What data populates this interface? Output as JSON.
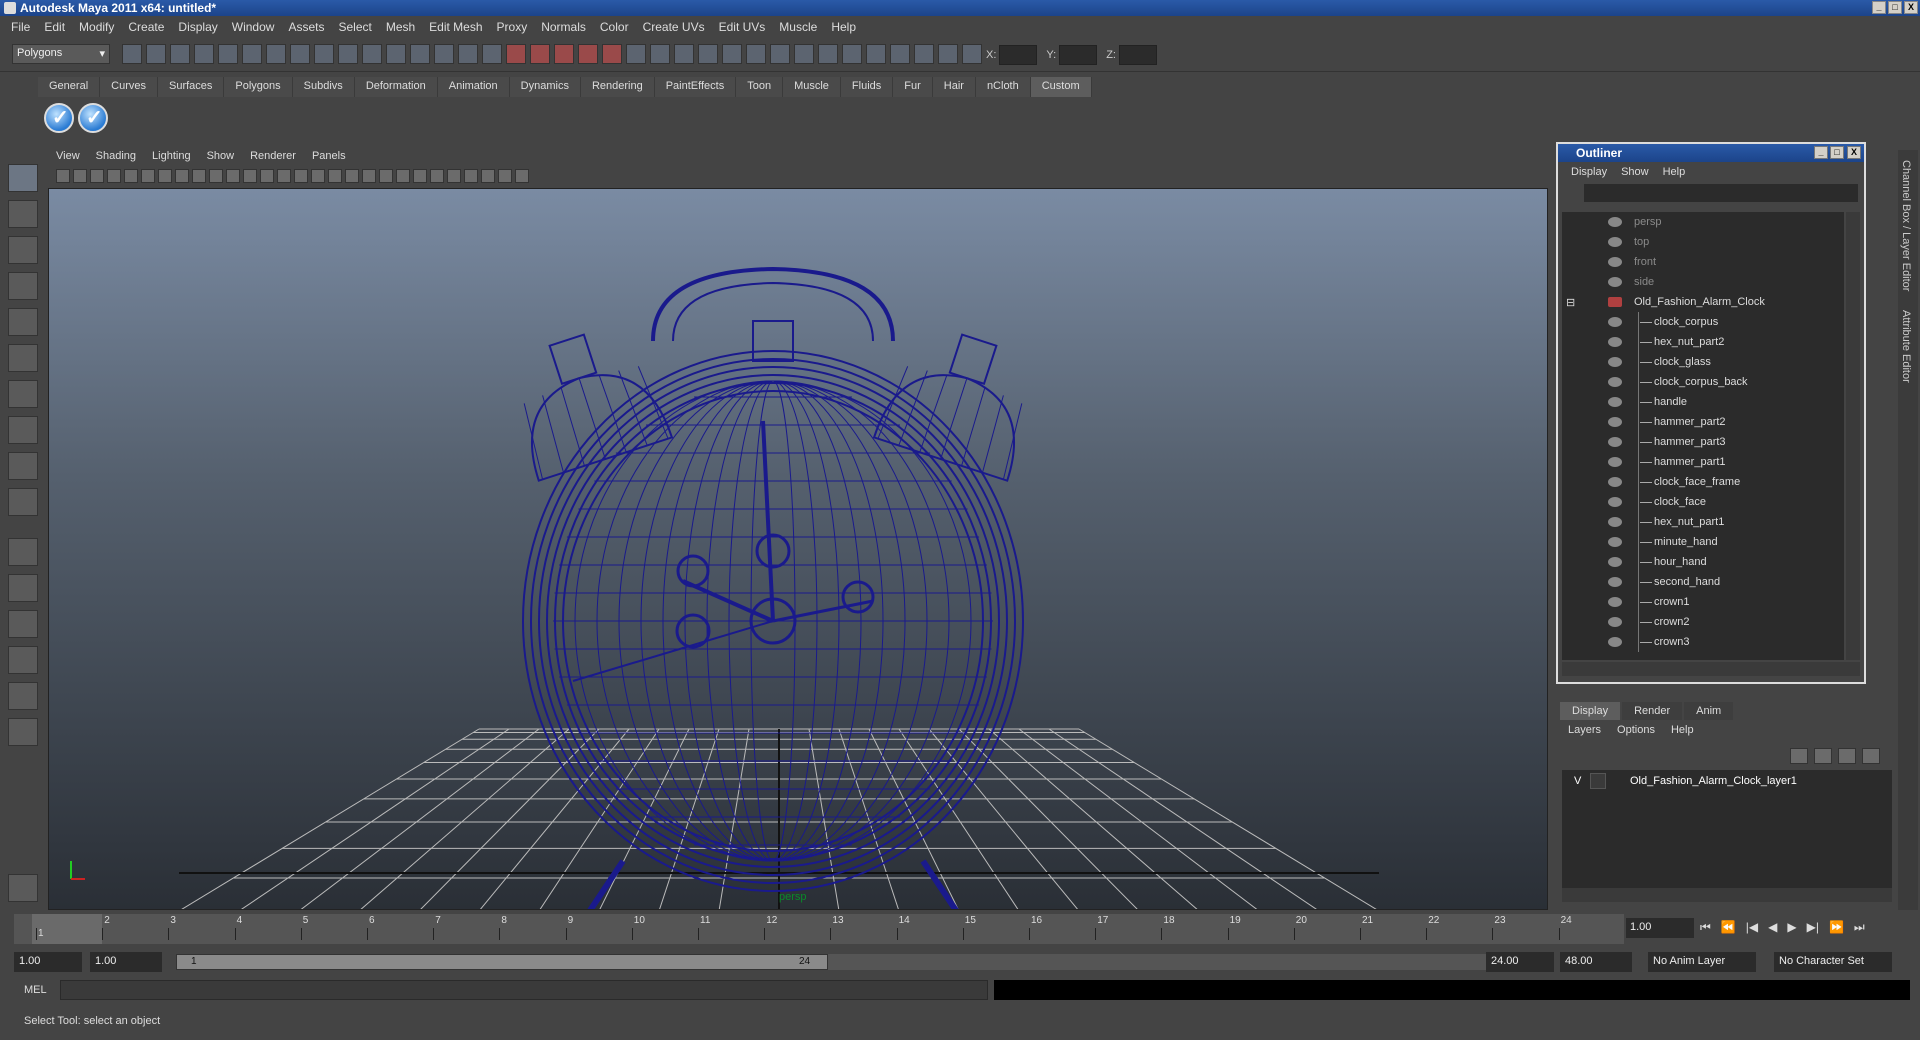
{
  "window": {
    "title": "Autodesk Maya 2011 x64: untitled*",
    "buttons": [
      "_",
      "□",
      "X"
    ]
  },
  "menubar": [
    "File",
    "Edit",
    "Modify",
    "Create",
    "Display",
    "Window",
    "Assets",
    "Select",
    "Mesh",
    "Edit Mesh",
    "Proxy",
    "Normals",
    "Color",
    "Create UVs",
    "Edit UVs",
    "Muscle",
    "Help"
  ],
  "statusline": {
    "mode": "Polygons",
    "x_label": "X:",
    "y_label": "Y:",
    "z_label": "Z:"
  },
  "shelf": {
    "tabs": [
      "General",
      "Curves",
      "Surfaces",
      "Polygons",
      "Subdivs",
      "Deformation",
      "Animation",
      "Dynamics",
      "Rendering",
      "PaintEffects",
      "Toon",
      "Muscle",
      "Fluids",
      "Fur",
      "Hair",
      "nCloth",
      "Custom"
    ],
    "active_tab": "Custom"
  },
  "viewport": {
    "menu": [
      "View",
      "Shading",
      "Lighting",
      "Show",
      "Renderer",
      "Panels"
    ],
    "camera_label": "persp",
    "wire_color": "#1a1a8c"
  },
  "outliner": {
    "title": "Outliner",
    "menu": [
      "Display",
      "Show",
      "Help"
    ],
    "cameras": [
      "persp",
      "top",
      "front",
      "side"
    ],
    "group": "Old_Fashion_Alarm_Clock",
    "children": [
      "clock_corpus",
      "hex_nut_part2",
      "clock_glass",
      "clock_corpus_back",
      "handle",
      "hammer_part2",
      "hammer_part3",
      "hammer_part1",
      "clock_face_frame",
      "clock_face",
      "hex_nut_part1",
      "minute_hand",
      "hour_hand",
      "second_hand",
      "crown1",
      "crown2",
      "crown3"
    ]
  },
  "side_strip": {
    "label1": "Channel Box / Layer Editor",
    "label2": "Attribute Editor"
  },
  "layer_editor": {
    "tabs": [
      "Display",
      "Render",
      "Anim"
    ],
    "active_tab": "Display",
    "menu": [
      "Layers",
      "Options",
      "Help"
    ],
    "layer": {
      "visible": "V",
      "name": "Old_Fashion_Alarm_Clock_layer1"
    }
  },
  "timeslider": {
    "ticks": [
      "1",
      "2",
      "3",
      "4",
      "5",
      "6",
      "7",
      "8",
      "9",
      "10",
      "11",
      "12",
      "13",
      "14",
      "15",
      "16",
      "17",
      "18",
      "19",
      "20",
      "21",
      "22",
      "23",
      "24"
    ],
    "current_time": "1.00",
    "current_frame_marker": "1"
  },
  "range": {
    "start": "1.00",
    "playback_start": "1.00",
    "handle_start": "1",
    "handle_end": "24",
    "playback_end": "24.00",
    "end": "48.00",
    "anim_layer": "No Anim Layer",
    "char_set": "No Character Set"
  },
  "playback_controls": [
    "⏮",
    "⏪",
    "|◀",
    "◀",
    "▶",
    "▶|",
    "⏩",
    "⏭"
  ],
  "commandline": {
    "label": "MEL"
  },
  "helpline": "Select Tool: select an object"
}
